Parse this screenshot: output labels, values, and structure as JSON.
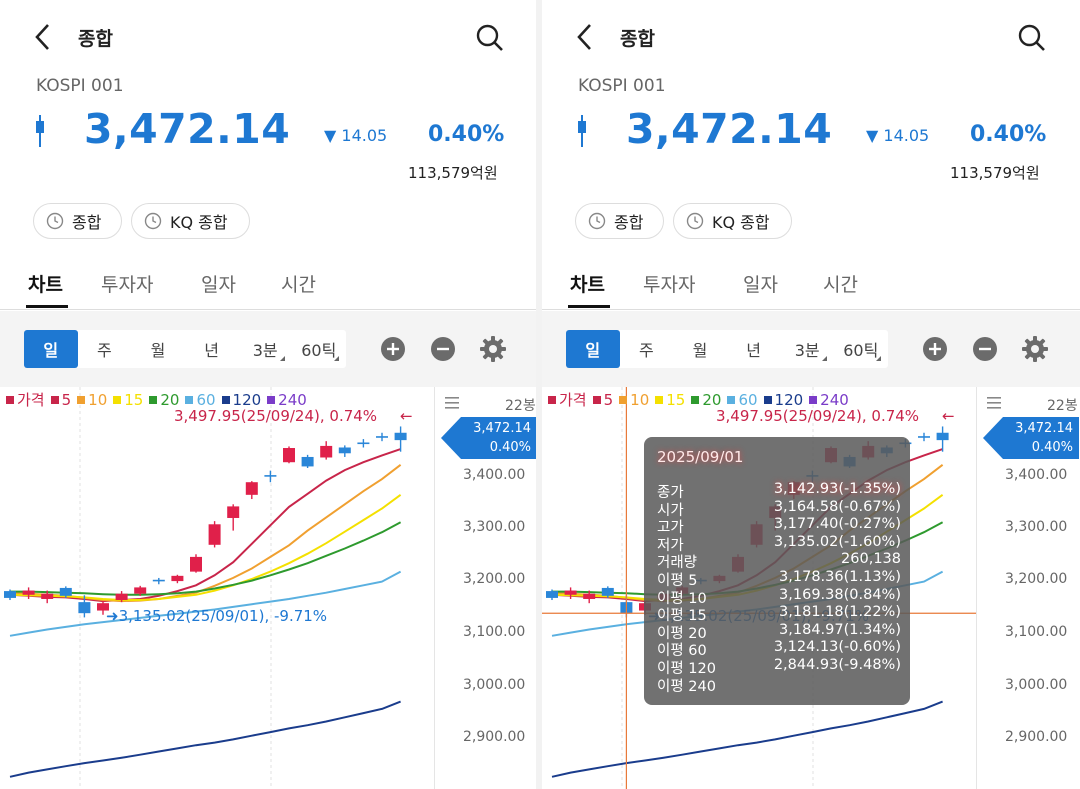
{
  "header": {
    "title": "종합",
    "code": "KOSPI 001",
    "price": "3,472.14",
    "change": "14.05",
    "change_rate": "0.40%",
    "amount": "113,579억원"
  },
  "chips": [
    "종합",
    "KQ 종합"
  ],
  "tabs": [
    "차트",
    "투자자",
    "일자",
    "시간"
  ],
  "periods": [
    "일",
    "주",
    "월",
    "년",
    "3분",
    "60틱"
  ],
  "legend": [
    {
      "label": "가격",
      "color": "#c8254a"
    },
    {
      "label": "5",
      "color": "#c8254a"
    },
    {
      "label": "10",
      "color": "#f0a030"
    },
    {
      "label": "15",
      "color": "#f4e000"
    },
    {
      "label": "20",
      "color": "#2e9a2e"
    },
    {
      "label": "60",
      "color": "#5ab0e0"
    },
    {
      "label": "120",
      "color": "#1a3c8c"
    },
    {
      "label": "240",
      "color": "#7a3cc8"
    }
  ],
  "chart": {
    "high_label": "3,497.95(25/09/24), 0.74%",
    "low_label": "3,135.02(25/09/01), -9.71%",
    "bars": "22봉",
    "current_tag": [
      "3,472.14",
      "0.40%"
    ],
    "y_ticks": [
      "3,400.00",
      "3,300.00",
      "3,200.00",
      "3,100.00",
      "3,000.00",
      "2,900.00"
    ]
  },
  "tooltip": {
    "date": "2025/09/01",
    "rows": [
      {
        "label": "종가",
        "value": "3,142.93(-1.35%)"
      },
      {
        "label": "시가",
        "value": "3,164.58(-0.67%)"
      },
      {
        "label": "고가",
        "value": "3,177.40(-0.27%)"
      },
      {
        "label": "저가",
        "value": "3,135.02(-1.60%)"
      },
      {
        "label": "거래량",
        "value": "260,138"
      },
      {
        "label": "이평 5",
        "value": "3,178.36(1.13%)"
      },
      {
        "label": "이평 10",
        "value": "3,169.38(0.84%)"
      },
      {
        "label": "이평 15",
        "value": "3,181.18(1.22%)"
      },
      {
        "label": "이평 20",
        "value": "3,184.97(1.34%)"
      },
      {
        "label": "이평 60",
        "value": "3,124.13(-0.60%)"
      },
      {
        "label": "이평 120",
        "value": "2,844.93(-9.48%)"
      },
      {
        "label": "이평 240",
        "value": ""
      }
    ]
  },
  "chart_data": {
    "type": "candlestick",
    "ylim": [
      2840,
      3500
    ],
    "y_ticks": [
      3400,
      3300,
      3200,
      3100,
      3000,
      2900
    ],
    "candles": [
      {
        "o": 3185,
        "c": 3172,
        "h": 3188,
        "l": 3168
      },
      {
        "o": 3178,
        "c": 3186,
        "h": 3192,
        "l": 3170
      },
      {
        "o": 3170,
        "c": 3180,
        "h": 3186,
        "l": 3162
      },
      {
        "o": 3191,
        "c": 3176,
        "h": 3194,
        "l": 3172
      },
      {
        "o": 3164,
        "c": 3143,
        "h": 3177,
        "l": 3135
      },
      {
        "o": 3148,
        "c": 3162,
        "h": 3166,
        "l": 3140
      },
      {
        "o": 3168,
        "c": 3180,
        "h": 3185,
        "l": 3164
      },
      {
        "o": 3180,
        "c": 3192,
        "h": 3195,
        "l": 3176
      },
      {
        "o": 3205,
        "c": 3205,
        "h": 3210,
        "l": 3198
      },
      {
        "o": 3204,
        "c": 3214,
        "h": 3216,
        "l": 3200
      },
      {
        "o": 3222,
        "c": 3250,
        "h": 3255,
        "l": 3220
      },
      {
        "o": 3273,
        "c": 3312,
        "h": 3318,
        "l": 3268
      },
      {
        "o": 3324,
        "c": 3346,
        "h": 3350,
        "l": 3300
      },
      {
        "o": 3368,
        "c": 3392,
        "h": 3394,
        "l": 3360
      },
      {
        "o": 3404,
        "c": 3404,
        "h": 3414,
        "l": 3392
      },
      {
        "o": 3430,
        "c": 3457,
        "h": 3460,
        "l": 3428
      },
      {
        "o": 3440,
        "c": 3422,
        "h": 3444,
        "l": 3419
      },
      {
        "o": 3439,
        "c": 3461,
        "h": 3470,
        "l": 3435
      },
      {
        "o": 3458,
        "c": 3447,
        "h": 3462,
        "l": 3440
      },
      {
        "o": 3466,
        "c": 3466,
        "h": 3474,
        "l": 3458
      },
      {
        "o": 3478,
        "c": 3478,
        "h": 3486,
        "l": 3470
      },
      {
        "o": 3486,
        "c": 3472,
        "h": 3498,
        "l": 3450
      }
    ],
    "ma": {
      "5": [
        3178,
        3176,
        3174,
        3173,
        3170,
        3166,
        3168,
        3170,
        3176,
        3185,
        3196,
        3215,
        3240,
        3275,
        3310,
        3345,
        3370,
        3395,
        3415,
        3430,
        3443,
        3455
      ],
      "10": [
        3182,
        3180,
        3178,
        3176,
        3172,
        3168,
        3166,
        3167,
        3170,
        3176,
        3182,
        3195,
        3210,
        3228,
        3250,
        3272,
        3300,
        3325,
        3350,
        3375,
        3398,
        3425
      ],
      "15": [
        3178,
        3177,
        3176,
        3175,
        3173,
        3170,
        3168,
        3168,
        3170,
        3174,
        3178,
        3186,
        3196,
        3208,
        3222,
        3238,
        3256,
        3276,
        3298,
        3320,
        3342,
        3368
      ],
      "20": [
        3184,
        3184,
        3183,
        3182,
        3181,
        3179,
        3178,
        3178,
        3179,
        3181,
        3184,
        3190,
        3197,
        3205,
        3215,
        3226,
        3238,
        3252,
        3266,
        3281,
        3297,
        3316
      ],
      "60": [
        3100,
        3106,
        3112,
        3117,
        3122,
        3126,
        3130,
        3134,
        3138,
        3142,
        3146,
        3150,
        3155,
        3160,
        3165,
        3170,
        3176,
        3182,
        3189,
        3196,
        3203,
        3222
      ],
      "120": [
        2832,
        2840,
        2846,
        2852,
        2858,
        2863,
        2868,
        2874,
        2880,
        2886,
        2892,
        2897,
        2903,
        2910,
        2917,
        2924,
        2930,
        2937,
        2945,
        2953,
        2961,
        2975
      ]
    },
    "high": {
      "value": 3497.95,
      "date": "25/09/24",
      "rate": "0.74%"
    },
    "low": {
      "value": 3135.02,
      "date": "25/09/01",
      "rate": "-9.71%"
    },
    "crosshair": {
      "index": 4,
      "value": 3142.93
    }
  }
}
